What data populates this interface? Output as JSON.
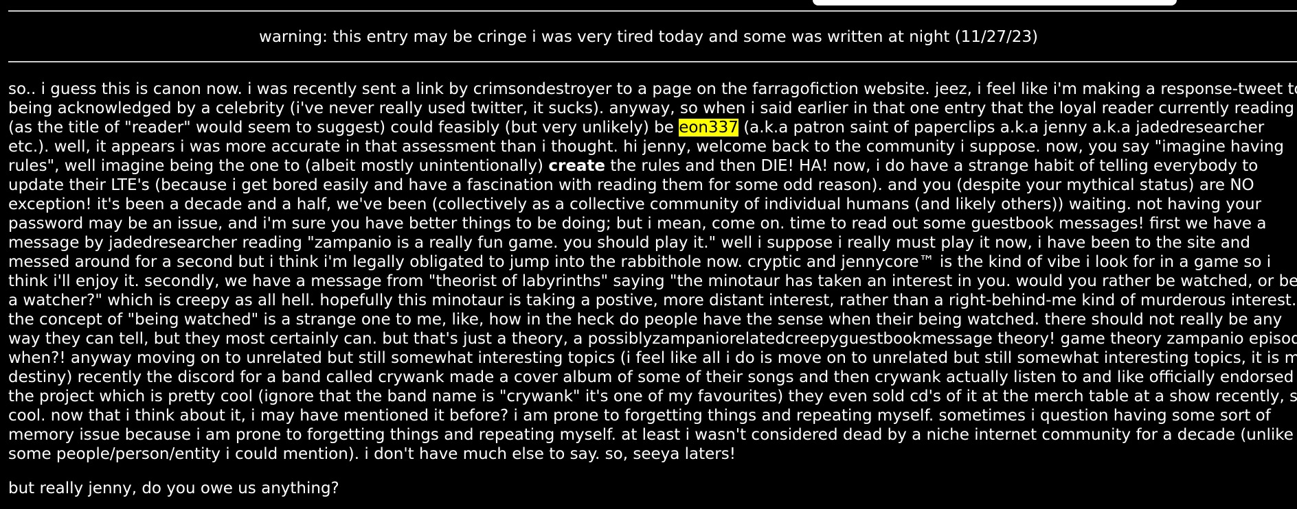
{
  "header": {
    "warning": "warning: this entry may be cringe i was very tired today and some was written at night (11/27/23)"
  },
  "entry": {
    "l1": "so.. i guess this is canon now. i was recently sent a link by crimsondestroyer to a page on the farragofiction website. jeez, i feel like i'm making a response-tweet to",
    "l2": "being acknowledged by a celebrity (i've never really used twitter, it sucks). anyway, so when i said earlier in that one entry that the loyal reader currently reading",
    "l3_a": "(as the title of \"reader\" would seem to suggest) could feasibly (but very unlikely) be ",
    "l3_highlight": "eon337",
    "l3_b": " (a.k.a patron saint of paperclips a.k.a jenny a.k.a jadedresearcher",
    "l4": "etc.). well, it appears i was more accurate in that assessment than i thought. hi jenny, welcome back to the community i suppose. now, you say \"imagine having",
    "l5_a": "rules\", well imagine being the one to (albeit mostly unintentionally) ",
    "l5_bold": "create",
    "l5_b": " the rules and then DIE! HA! now, i do have a strange habit of telling everybody to",
    "l6": "update their LTE's (because i get bored easily and have a fascination with reading them for some odd reason). and you (despite your mythical status) are NO",
    "l7": "exception! it's been a decade and a half, we've been (collectively as a collective community of individual humans (and likely others)) waiting. not having your",
    "l8": "password may be an issue, and i'm sure you have better things to be doing; but i mean, come on. time to read out some guestbook messages! first we have a",
    "l9": "message by jadedresearcher reading \"zampanio is a really fun game. you should play it.\" well i suppose i really must play it now, i have been to the site and",
    "l10": "messed around for a second but i think i'm legally obligated to jump into the rabbithole now. cryptic and jennycore™ is the kind of vibe i look for in a game so i",
    "l11": "think i'll enjoy it. secondly, we have a message from \"theorist of labyrinths\" saying \"the minotaur has taken an interest in you. would you rather be watched, or be",
    "l12": "a watcher?\" which is creepy as all hell. hopefully this minotaur is taking a postive, more distant interest, rather than a right-behind-me kind of murderous interest.",
    "l13": "the concept of \"being watched\" is a strange one to me, like, how in the heck do people have the sense when their being watched. there should not really be any",
    "l14": "way they can tell, but they most certainly can. but that's just a theory, a possiblyzampaniorelatedcreepyguestbookmessage theory! game theory zampanio episode",
    "l15": "when?! anyway moving on to unrelated but still somewhat interesting topics (i feel like all i do is move on to unrelated but still somewhat interesting topics, it is my",
    "l16": "destiny) recently the discord for a band called crywank made a cover album of some of their songs and then crywank actually listen to and like officially endorsed",
    "l17": "the project which is pretty cool (ignore that the band name is \"crywank\" it's one of my favourites) they even sold cd's of it at the merch table at a show recently, so",
    "l18": "cool. now that i think about it, i may have mentioned it before? i am prone to forgetting things and repeating myself. sometimes i question having some sort of",
    "l19": "memory issue because i am prone to forgetting things and repeating myself. at least i wasn't considered dead by a niche internet community for a decade (unlike",
    "l20": "some people/person/entity i could mention). i don't have much else to say. so, seeya laters!"
  },
  "closing": "but really jenny, do you owe us anything?",
  "colors": {
    "background": "#000000",
    "text": "#ffffff",
    "highlight": "#ffff00"
  }
}
